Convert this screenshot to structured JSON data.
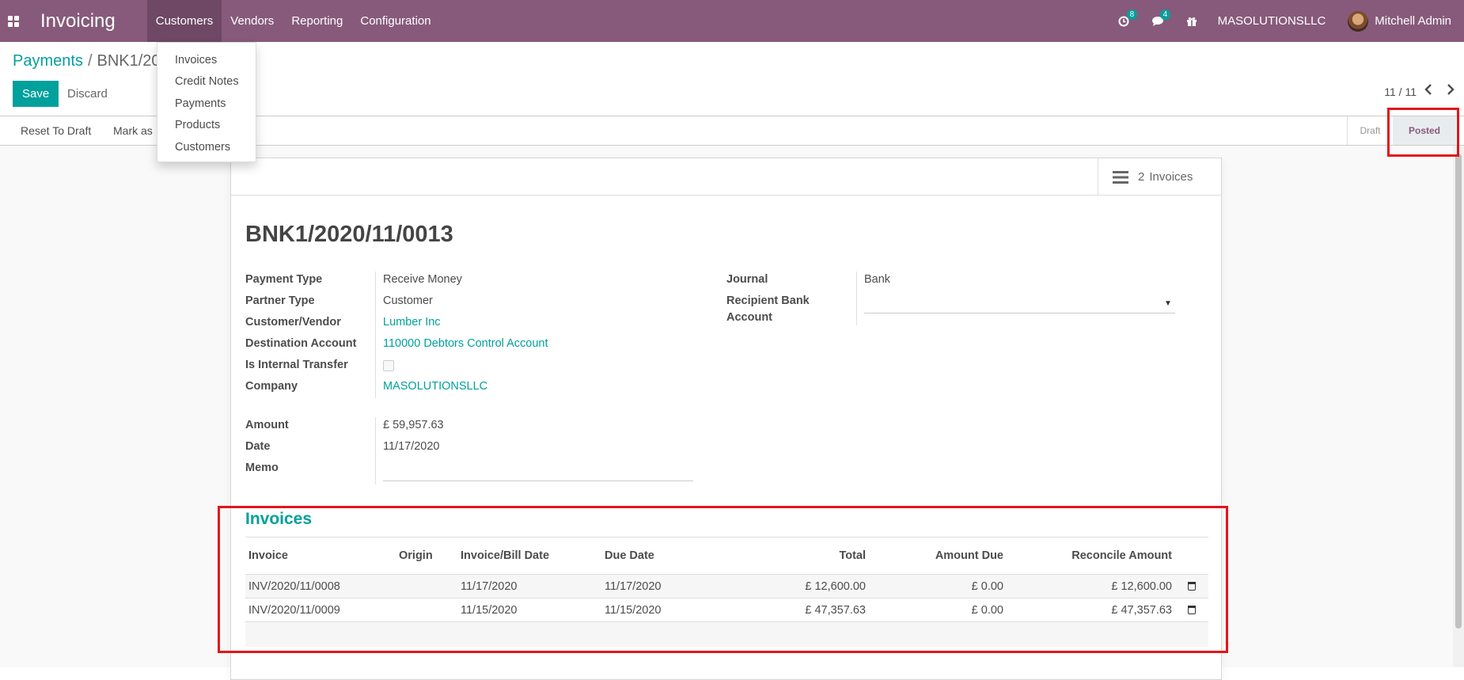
{
  "app": {
    "title": "Invoicing"
  },
  "nav": {
    "menu": [
      "Customers",
      "Vendors",
      "Reporting",
      "Configuration"
    ],
    "activity_count": "8",
    "message_count": "4",
    "company": "MASOLUTIONSLLC",
    "user": "Mitchell Admin",
    "icons": [
      "apps-icon",
      "clock-icon",
      "chat-icon",
      "gift-icon"
    ]
  },
  "dropdown": {
    "items": [
      "Invoices",
      "Credit Notes",
      "Payments",
      "Products",
      "Customers"
    ]
  },
  "breadcrumb": {
    "parent": "Payments",
    "separator": "/",
    "current": "BNK1/20"
  },
  "actions": {
    "save": "Save",
    "discard": "Discard"
  },
  "pager": {
    "value": "11 / 11"
  },
  "statusbar": {
    "reset": "Reset To Draft",
    "mark": "Mark as",
    "stages": [
      "Draft",
      "Posted"
    ],
    "active_stage": "Posted"
  },
  "smart_button": {
    "count": "2",
    "label": "Invoices"
  },
  "record": {
    "name": "BNK1/2020/11/0013",
    "left_fields": [
      {
        "label": "Payment Type",
        "value": "Receive Money"
      },
      {
        "label": "Partner Type",
        "value": "Customer"
      },
      {
        "label": "Customer/Vendor",
        "value": "Lumber Inc"
      },
      {
        "label": "Destination Account",
        "value": "110000 Debtors Control Account"
      },
      {
        "label": "Is Internal Transfer",
        "value": ""
      },
      {
        "label": "Company",
        "value": "MASOLUTIONSLLC"
      }
    ],
    "amount_fields": [
      {
        "label": "Amount",
        "value": "£ 59,957.63"
      },
      {
        "label": "Date",
        "value": "11/17/2020"
      },
      {
        "label": "Memo",
        "value": ""
      }
    ],
    "right_fields": [
      {
        "label": "Journal",
        "value": "Bank"
      },
      {
        "label_line1": "Recipient Bank",
        "label_line2": "Account",
        "value": ""
      }
    ]
  },
  "invoices": {
    "title": "Invoices",
    "columns": [
      "Invoice",
      "Origin",
      "Invoice/Bill Date",
      "Due Date",
      "Total",
      "Amount Due",
      "Reconcile Amount"
    ],
    "rows": [
      {
        "invoice": "INV/2020/11/0008",
        "origin": "",
        "invoice_date": "11/17/2020",
        "due_date": "11/17/2020",
        "total": "£ 12,600.00",
        "amount_due": "£ 0.00",
        "reconcile": "£ 12,600.00"
      },
      {
        "invoice": "INV/2020/11/0009",
        "origin": "",
        "invoice_date": "11/15/2020",
        "due_date": "11/15/2020",
        "total": "£ 47,357.63",
        "amount_due": "£ 0.00",
        "reconcile": "£ 47,357.63"
      }
    ]
  },
  "colors": {
    "brand": "#875a7b",
    "accent": "#00a09d",
    "highlight": "#e3151a"
  }
}
